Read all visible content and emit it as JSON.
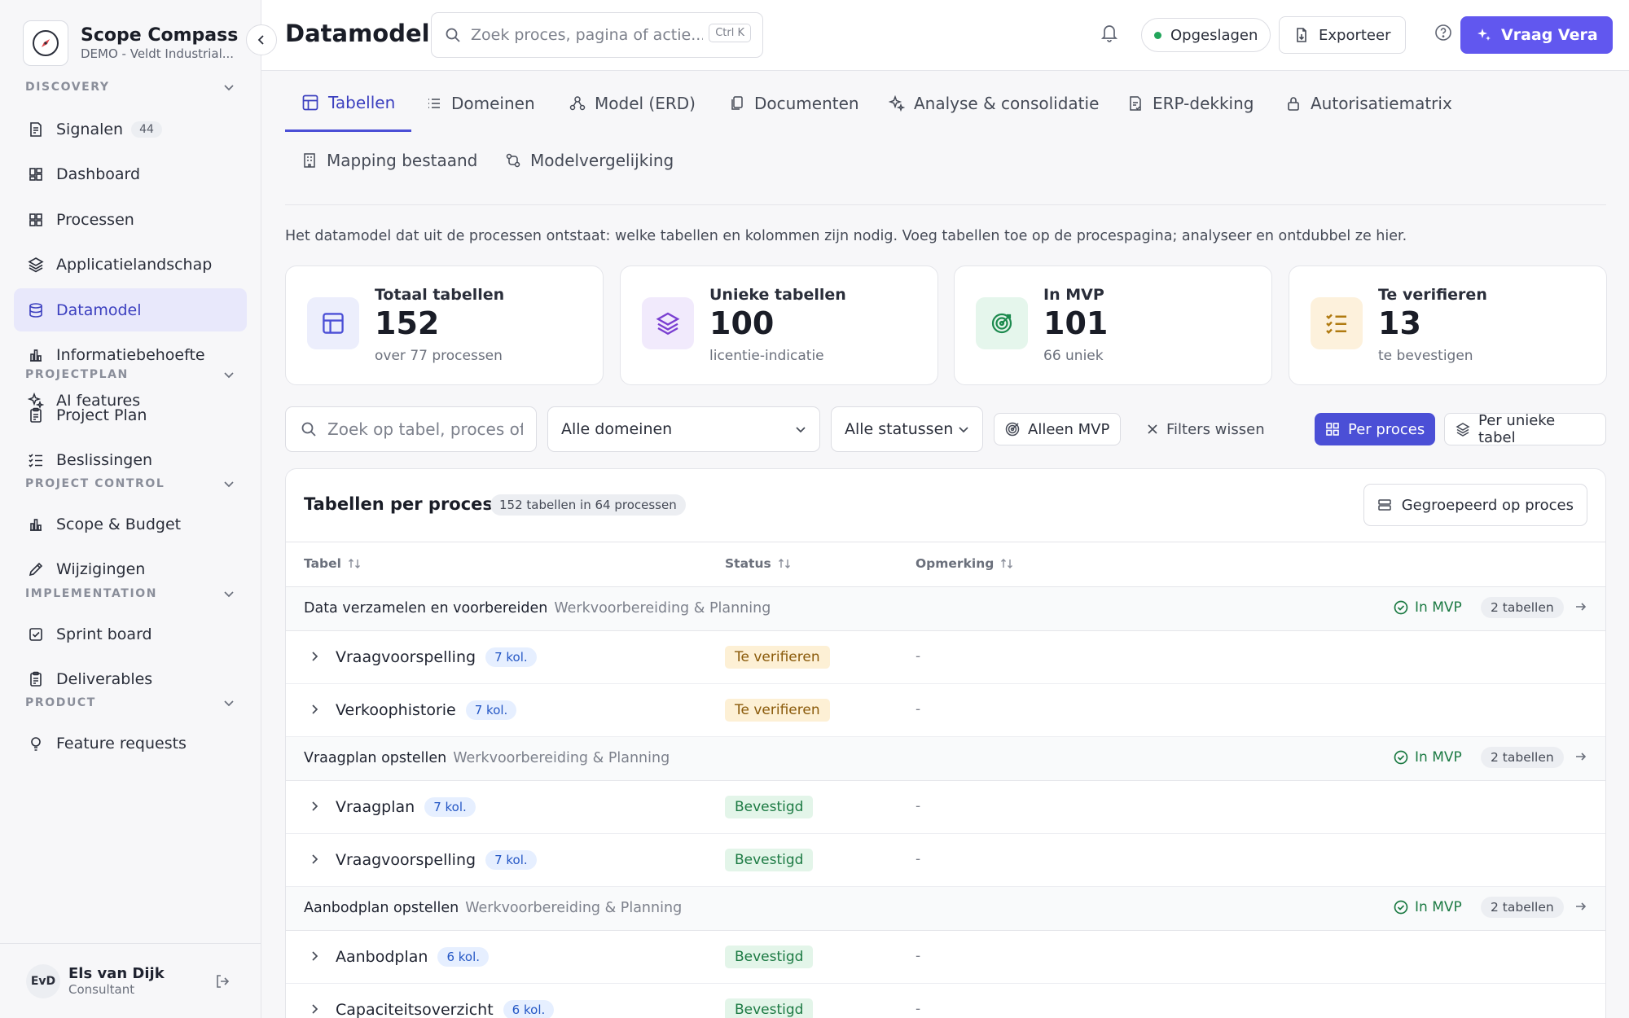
{
  "brand": {
    "title": "Scope Compass",
    "subtitle": "DEMO - Veldt Industrial..."
  },
  "sidebar": {
    "sections": [
      {
        "title": "DISCOVERY",
        "items": [
          {
            "label": "Signalen",
            "badge": "44",
            "icon": "signal-doc-icon"
          },
          {
            "label": "Dashboard",
            "icon": "dashboard-icon"
          },
          {
            "label": "Processen",
            "icon": "grid-icon"
          },
          {
            "label": "Applicatielandschap",
            "icon": "layers-icon"
          },
          {
            "label": "Datamodel",
            "icon": "database-icon",
            "active": true
          },
          {
            "label": "Informatiebehoefte",
            "icon": "bar-chart-icon"
          },
          {
            "label": "AI features",
            "icon": "sparkles-icon"
          }
        ]
      },
      {
        "title": "PROJECTPLAN",
        "items": [
          {
            "label": "Project Plan",
            "icon": "clipboard-icon"
          },
          {
            "label": "Beslissingen",
            "icon": "checklist-icon"
          }
        ]
      },
      {
        "title": "PROJECT CONTROL",
        "items": [
          {
            "label": "Scope & Budget",
            "icon": "bar-chart-icon"
          },
          {
            "label": "Wijzigingen",
            "icon": "pencil-icon"
          }
        ]
      },
      {
        "title": "IMPLEMENTATION",
        "items": [
          {
            "label": "Sprint board",
            "icon": "checkbox-icon"
          },
          {
            "label": "Deliverables",
            "icon": "clipboard-icon"
          }
        ]
      },
      {
        "title": "PRODUCT",
        "items": [
          {
            "label": "Feature requests",
            "icon": "bulb-icon"
          }
        ]
      }
    ]
  },
  "user": {
    "initials": "EvD",
    "name": "Els van Dijk",
    "role": "Consultant"
  },
  "topbar": {
    "title": "Datamodel",
    "search_placeholder": "Zoek proces, pagina of actie...",
    "shortcut": "Ctrl K",
    "saved_label": "Opgeslagen",
    "export_label": "Exporteer",
    "ask_label": "Vraag Vera"
  },
  "tabs": [
    {
      "label": "Tabellen",
      "icon": "table-icon",
      "active": true
    },
    {
      "label": "Domeinen",
      "icon": "list-icon"
    },
    {
      "label": "Model (ERD)",
      "icon": "erd-icon"
    },
    {
      "label": "Documenten",
      "icon": "documents-icon"
    },
    {
      "label": "Analyse & consolidatie",
      "icon": "sparkles-icon"
    },
    {
      "label": "ERP-dekking",
      "icon": "erp-doc-icon"
    },
    {
      "label": "Autorisatiematrix",
      "icon": "lock-icon"
    },
    {
      "label": "Mapping bestaand",
      "icon": "building-icon"
    },
    {
      "label": "Modelvergelijking",
      "icon": "compare-icon"
    }
  ],
  "intro": "Het datamodel dat uit de processen ontstaat: welke tabellen en kolommen zijn nodig. Voeg tabellen toe op de procespagina; analyseer en ontdubbel ze hier.",
  "stats": [
    {
      "label": "Totaal tabellen",
      "value": "152",
      "sub": "over 77 processen",
      "icon": "table-icon",
      "color": "#4b4fd6",
      "bg": "#eceefc"
    },
    {
      "label": "Unieke tabellen",
      "value": "100",
      "sub": "licentie-indicatie",
      "icon": "layers-icon",
      "color": "#7a3fd1",
      "bg": "#f1eafc"
    },
    {
      "label": "In MVP",
      "value": "101",
      "sub": "66 uniek",
      "icon": "target-icon",
      "color": "#1c8a4e",
      "bg": "#e5f6ec"
    },
    {
      "label": "Te verifieren",
      "value": "13",
      "sub": "te bevestigen",
      "icon": "checklist-icon",
      "color": "#b07a10",
      "bg": "#fdf1dc"
    }
  ],
  "filters": {
    "search_placeholder": "Zoek op tabel, proces of",
    "domain_select": "Alle domeinen",
    "status_select": "Alle statussen",
    "mvp_only": "Alleen MVP",
    "clear": "Filters wissen",
    "view_per_process": "Per proces",
    "view_per_table": "Per unieke tabel"
  },
  "table": {
    "title": "Tabellen per proces",
    "count": "152 tabellen in 64 processen",
    "group_button": "Gegroepeerd op proces",
    "columns": [
      "Tabel",
      "Status",
      "Opmerking"
    ],
    "groups": [
      {
        "name": "Data verzamelen en voorbereiden",
        "domain": "Werkvoorbereiding & Planning",
        "status": "In MVP",
        "count": "2 tabellen",
        "rows": [
          {
            "name": "Vraagvoorspelling",
            "kol": "7 kol.",
            "status": "Te verifieren",
            "kind": "verify",
            "remark": "-"
          },
          {
            "name": "Verkoophistorie",
            "kol": "7 kol.",
            "status": "Te verifieren",
            "kind": "verify",
            "remark": "-"
          }
        ]
      },
      {
        "name": "Vraagplan opstellen",
        "domain": "Werkvoorbereiding & Planning",
        "status": "In MVP",
        "count": "2 tabellen",
        "rows": [
          {
            "name": "Vraagplan",
            "kol": "7 kol.",
            "status": "Bevestigd",
            "kind": "ok",
            "remark": "-"
          },
          {
            "name": "Vraagvoorspelling",
            "kol": "7 kol.",
            "status": "Bevestigd",
            "kind": "ok",
            "remark": "-"
          }
        ]
      },
      {
        "name": "Aanbodplan opstellen",
        "domain": "Werkvoorbereiding & Planning",
        "status": "In MVP",
        "count": "2 tabellen",
        "rows": [
          {
            "name": "Aanbodplan",
            "kol": "6 kol.",
            "status": "Bevestigd",
            "kind": "ok",
            "remark": "-"
          },
          {
            "name": "Capaciteitsoverzicht",
            "kol": "6 kol.",
            "status": "Bevestigd",
            "kind": "ok",
            "remark": "-"
          }
        ]
      }
    ]
  }
}
